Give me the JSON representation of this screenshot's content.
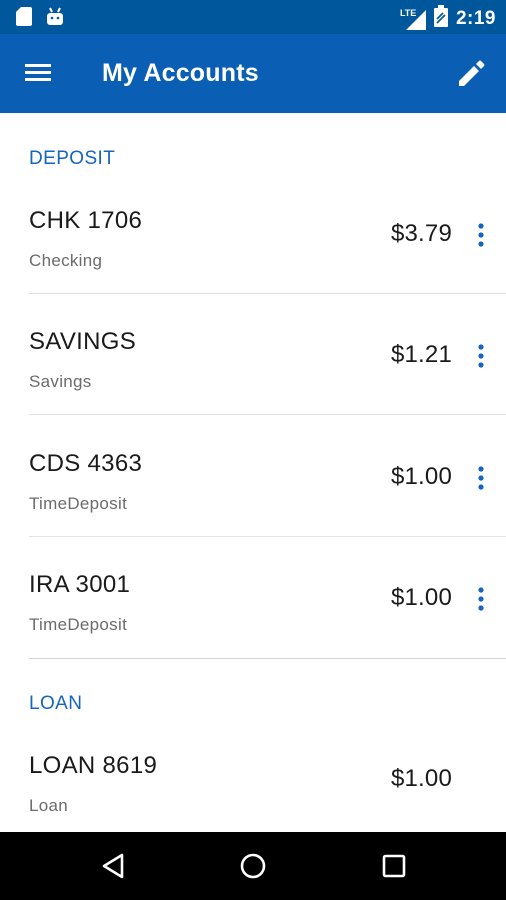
{
  "status_bar": {
    "time": "2:19",
    "network_label": "LTE",
    "icons": [
      "sd-card-icon",
      "android-icon",
      "signal-icon",
      "battery-icon"
    ]
  },
  "app_bar": {
    "title": "My Accounts",
    "menu_icon": "menu-icon",
    "edit_icon": "edit-icon"
  },
  "sections": [
    {
      "header": "DEPOSIT",
      "accounts": [
        {
          "name": "CHK 1706",
          "type": "Checking",
          "balance": "$3.79"
        },
        {
          "name": "SAVINGS",
          "type": "Savings",
          "balance": "$1.21"
        },
        {
          "name": "CDS 4363",
          "type": "TimeDeposit",
          "balance": "$1.00"
        },
        {
          "name": "IRA 3001",
          "type": "TimeDeposit",
          "balance": "$1.00"
        }
      ]
    },
    {
      "header": "LOAN",
      "accounts": [
        {
          "name": "LOAN 8619",
          "type": "Loan",
          "balance": "$1.00"
        }
      ]
    }
  ],
  "colors": {
    "status_bar": "#01579b",
    "app_bar": "#0a5fb4",
    "accent": "#1565c0",
    "nav_bar": "#000000"
  },
  "nav_bar": {
    "icons": [
      "back-icon",
      "home-icon",
      "recents-icon"
    ]
  }
}
